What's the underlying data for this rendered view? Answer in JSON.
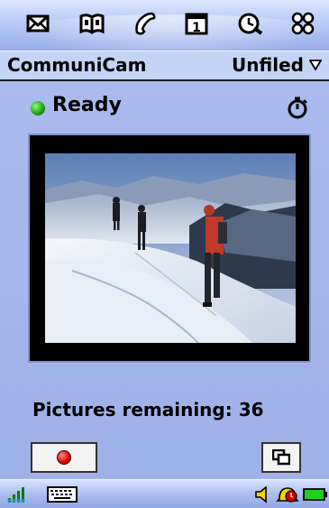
{
  "toolbar": {
    "apps": [
      {
        "icon": "envelope-icon"
      },
      {
        "icon": "book-icon"
      },
      {
        "icon": "phone-icon"
      },
      {
        "icon": "calendar-icon"
      },
      {
        "icon": "clock-search-icon"
      },
      {
        "icon": "apps-grid-icon"
      }
    ],
    "calendar_day": "1"
  },
  "titlebar": {
    "app_title": "CommuniCam",
    "folder_label": "Unfiled"
  },
  "camera": {
    "status_label": "Ready",
    "status_color": "#1c9c1c",
    "timer_icon": "self-timer-icon",
    "pictures_remaining_label": "Pictures remaining: 36",
    "capture_icon": "record-dot-icon",
    "mode_icon": "overlap-windows-icon"
  },
  "statusbar": {
    "icons": [
      "signal-strength-icon",
      "keyboard-icon",
      "speaker-icon",
      "alarm-icon",
      "battery-icon"
    ],
    "battery_color": "#1fd11f"
  },
  "colors": {
    "background": "#a4b6ec",
    "title_bar": "#c4d4f5",
    "record_red": "#e00000"
  }
}
